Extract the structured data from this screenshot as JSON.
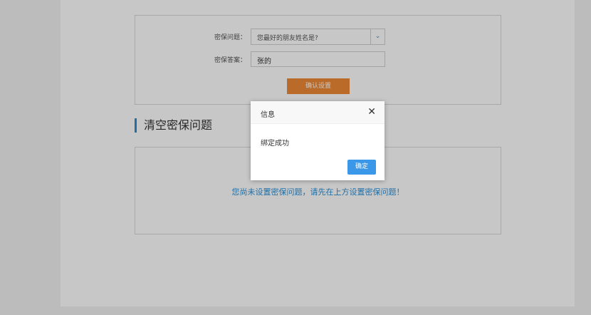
{
  "form": {
    "question_label": "密保问题：",
    "question_value": "您最好的朋友姓名是?",
    "answer_label": "密保答案：",
    "answer_value": "张的",
    "confirm_label": "确认设置"
  },
  "clear_section": {
    "title": "清空密保问题",
    "empty_message": "您尚未设置密保问题，请先在上方设置密保问题！"
  },
  "dialog": {
    "title": "信息",
    "message": "绑定成功",
    "ok_label": "确定"
  },
  "colors": {
    "accent": "#2b8fd6",
    "confirm_button": "#ef8a36",
    "dialog_ok": "#3b98e8"
  }
}
